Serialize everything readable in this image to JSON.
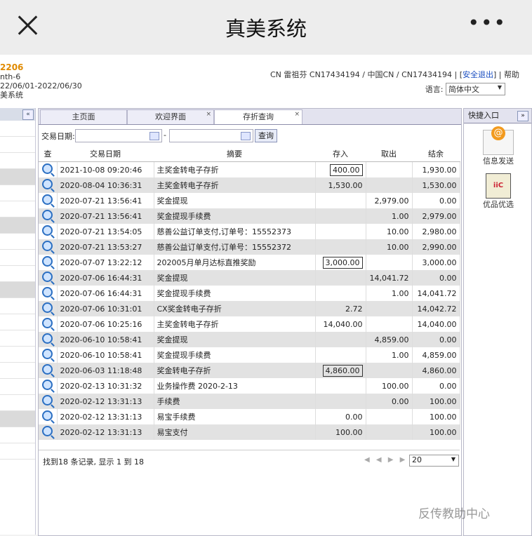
{
  "app_title": "真美系统",
  "more_label": "•••",
  "sys_info": {
    "code": "2206",
    "line1": "nth-6",
    "range": "22/06/01-2022/06/30",
    "name": "美系统"
  },
  "user_bar": {
    "user_text": "CN 雷祖芬 CN17434194 / 中国CN / CN17434194 | [",
    "logout": "安全退出",
    "help_sep": "] | 帮助",
    "lang_label": "语言:",
    "lang_value": "简体中文"
  },
  "tabs": [
    {
      "label": "主页面"
    },
    {
      "label": "欢迎界面"
    },
    {
      "label": "存折查询"
    }
  ],
  "search": {
    "date_label": "交易日期:",
    "dash": "-",
    "query_button": "查询"
  },
  "table": {
    "headers": [
      "查",
      "交易日期",
      "摘要",
      "存入",
      "取出",
      "结余"
    ],
    "rows": [
      {
        "date": "2021-10-08 09:20:46",
        "desc": "主奖金转电子存折",
        "in": "400.00",
        "out": "",
        "bal": "1,930.00",
        "boxed": true
      },
      {
        "date": "2020-08-04 10:36:31",
        "desc": "主奖金转电子存折",
        "in": "1,530.00",
        "out": "",
        "bal": "1,530.00",
        "boxed": false
      },
      {
        "date": "2020-07-21 13:56:41",
        "desc": "奖金提现",
        "in": "",
        "out": "2,979.00",
        "bal": "0.00",
        "boxed": false
      },
      {
        "date": "2020-07-21 13:56:41",
        "desc": "奖金提现手续费",
        "in": "",
        "out": "1.00",
        "bal": "2,979.00",
        "boxed": false
      },
      {
        "date": "2020-07-21 13:54:05",
        "desc": "慈善公益订单支付,订单号：15552373",
        "in": "",
        "out": "10.00",
        "bal": "2,980.00",
        "boxed": false
      },
      {
        "date": "2020-07-21 13:53:27",
        "desc": "慈善公益订单支付,订单号：15552372",
        "in": "",
        "out": "10.00",
        "bal": "2,990.00",
        "boxed": false
      },
      {
        "date": "2020-07-07 13:22:12",
        "desc": "202005月单月达标直推奖励",
        "in": "3,000.00",
        "out": "",
        "bal": "3,000.00",
        "boxed": true
      },
      {
        "date": "2020-07-06 16:44:31",
        "desc": "奖金提现",
        "in": "",
        "out": "14,041.72",
        "bal": "0.00",
        "boxed": false
      },
      {
        "date": "2020-07-06 16:44:31",
        "desc": "奖金提现手续费",
        "in": "",
        "out": "1.00",
        "bal": "14,041.72",
        "boxed": false
      },
      {
        "date": "2020-07-06 10:31:01",
        "desc": "CX奖金转电子存折",
        "in": "2.72",
        "out": "",
        "bal": "14,042.72",
        "boxed": false
      },
      {
        "date": "2020-07-06 10:25:16",
        "desc": "主奖金转电子存折",
        "in": "14,040.00",
        "out": "",
        "bal": "14,040.00",
        "boxed": false
      },
      {
        "date": "2020-06-10 10:58:41",
        "desc": "奖金提现",
        "in": "",
        "out": "4,859.00",
        "bal": "0.00",
        "boxed": false
      },
      {
        "date": "2020-06-10 10:58:41",
        "desc": "奖金提现手续费",
        "in": "",
        "out": "1.00",
        "bal": "4,859.00",
        "boxed": false
      },
      {
        "date": "2020-06-03 11:18:48",
        "desc": "奖金转电子存折",
        "in": "4,860.00",
        "out": "",
        "bal": "4,860.00",
        "boxed": true
      },
      {
        "date": "2020-02-13 10:31:32",
        "desc": "业务操作费 2020-2-13",
        "in": "",
        "out": "100.00",
        "bal": "0.00",
        "boxed": false
      },
      {
        "date": "2020-02-12 13:31:13",
        "desc": "手续费",
        "in": "",
        "out": "0.00",
        "bal": "100.00",
        "boxed": false
      },
      {
        "date": "2020-02-12 13:31:13",
        "desc": "易宝手续费",
        "in": "0.00",
        "out": "",
        "bal": "100.00",
        "boxed": false
      },
      {
        "date": "2020-02-12 13:31:13",
        "desc": "易宝支付",
        "in": "100.00",
        "out": "",
        "bal": "100.00",
        "boxed": false
      }
    ]
  },
  "footer": {
    "summary": "找到18 条记录, 显示 1 到 18",
    "page_size": "20"
  },
  "quick": {
    "title": "快捷入口",
    "items": [
      {
        "label": "信息发送",
        "icon": "envelope-icon"
      },
      {
        "label": "优品优选",
        "icon": "card-icon"
      }
    ]
  },
  "watermark": "反传教助中心"
}
